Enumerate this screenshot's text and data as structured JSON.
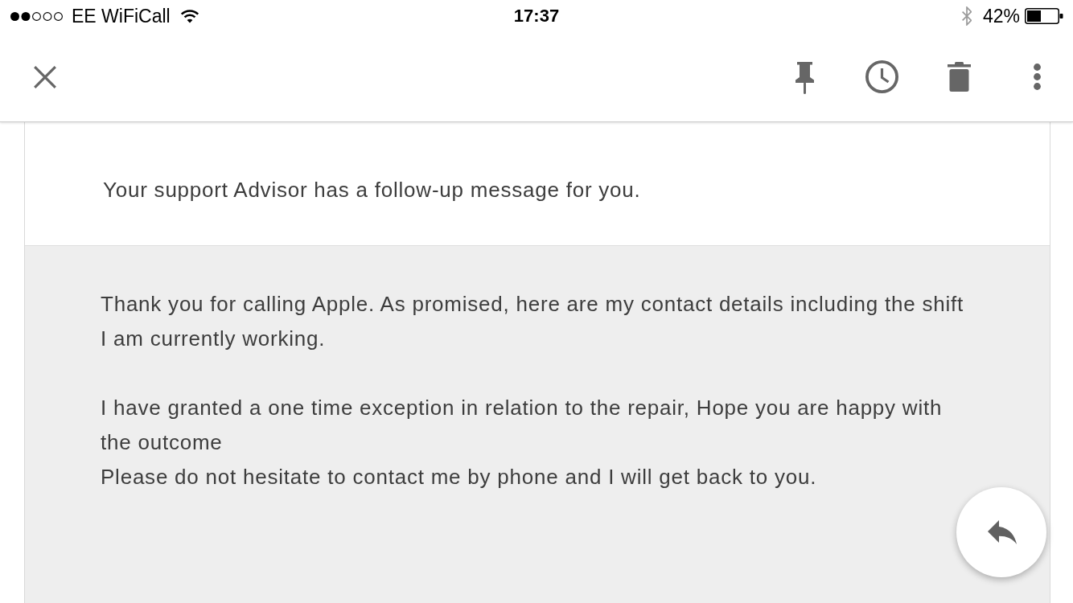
{
  "status_bar": {
    "carrier": "EE WiFiCall",
    "time": "17:37",
    "battery": "42%"
  },
  "email": {
    "intro": "Your support Advisor has a follow-up message for you.",
    "message": {
      "paragraphs": [
        {
          "lines": [
            "Thank you for calling Apple. As promised, here are my contact details including the shift I am currently working."
          ]
        },
        {
          "lines": [
            "I have granted a one time exception in relation to the repair, Hope you are happy with the outcome",
            "Please do not hesitate to contact me by phone and I will get back to you."
          ]
        }
      ]
    }
  }
}
